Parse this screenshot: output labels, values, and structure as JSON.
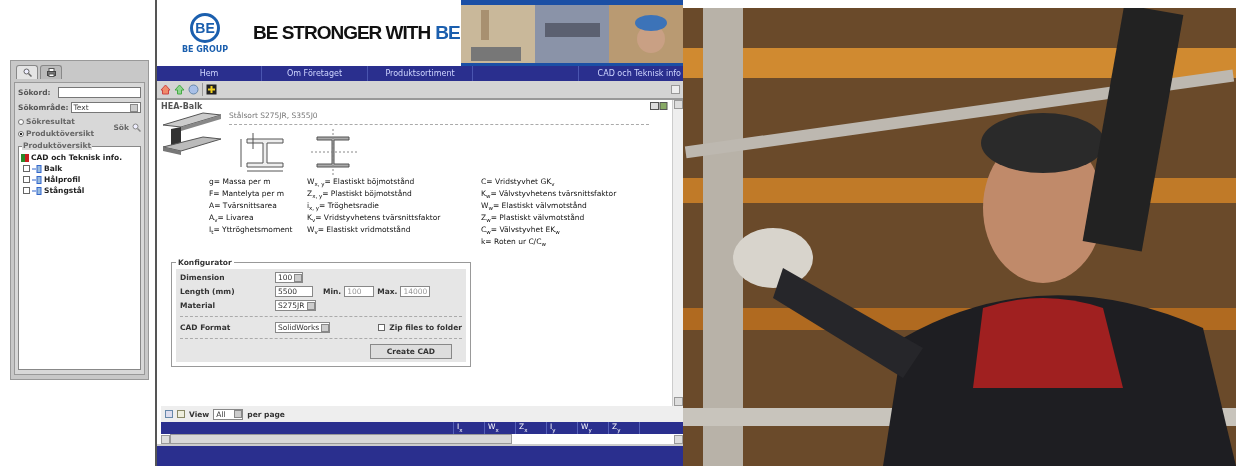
{
  "sidebar": {
    "tabs": [
      {
        "kind": "search",
        "selected": true
      },
      {
        "kind": "print",
        "selected": false
      }
    ],
    "fields": [
      {
        "kind": "text",
        "label": "Sökord:"
      },
      {
        "kind": "select",
        "label": "Sökområde:",
        "value": "Text"
      }
    ],
    "radios": [
      {
        "label": "Sökresultat",
        "selected": false
      },
      {
        "label": "Produktöversikt",
        "selected": true
      }
    ],
    "search_button": "Sök",
    "tree": {
      "title": "Produktöversikt",
      "items": [
        {
          "label": "CAD och Teknisk info.",
          "children": [
            {
              "label": "Balk",
              "expanded": false
            },
            {
              "label": "Hålprofil",
              "expanded": false
            },
            {
              "label": "Stångstål",
              "expanded": false
            }
          ]
        }
      ]
    }
  },
  "header": {
    "logo": "BE",
    "logo_caption": "BE GROUP",
    "slogan": "BE STRONGER WITH",
    "slogan_accent": "BE"
  },
  "nav": [
    {
      "label": "Hem"
    },
    {
      "label": "Om Företaget"
    },
    {
      "label": "Produktsortiment"
    },
    {
      "label": "CAD och Teknisk info"
    }
  ],
  "product": {
    "title": "HEA-Balk",
    "steel_grades": "Stålsort S275JR, S355J0",
    "legend_columns": [
      [
        "g= Massa per m",
        "F= Mantelyta per m",
        "A= Tvärsnittsarea",
        "A$_{v}$= Livarea",
        "I$_{t}$= Yttröghetsmoment"
      ],
      [
        "W$_{x, y}$= Elastiskt böjmotstånd",
        "Z$_{x, y}$= Plastiskt böjmotstånd",
        "i$_{x, y}$= Tröghetsradie",
        "K$_{v}$= Vridstyvhetens tvärsnittsfaktor",
        "W$_{v}$= Elastiskt vridmotstånd"
      ],
      [
        "C= Vridstyvhet GK$_{v}$",
        "K$_{w}$= Välvstyvhetens tvärsnittsfaktor",
        "W$_{w}$= Elastiskt välvmotstånd",
        "Z$_{w}$= Plastiskt välvmotstånd",
        "C$_{w}$= Välvstyvhet EK$_{w}$",
        "k= Roten ur C/C$_{w}$"
      ]
    ]
  },
  "configurator": {
    "title": "Konfigurator",
    "dimension": {
      "label": "Dimension",
      "value": "100"
    },
    "length": {
      "label": "Length (mm)",
      "value": "5500",
      "min_label": "Min.",
      "min": "100",
      "max_label": "Max.",
      "max": "14000"
    },
    "material": {
      "label": "Material",
      "value": "S275JR"
    },
    "cad_format": {
      "label": "CAD Format",
      "value": "SolidWorks"
    },
    "zip": {
      "label": "Zip files to folder",
      "checked": false
    },
    "create_button": "Create CAD"
  },
  "grid": {
    "view_label": "View",
    "view_value": "All",
    "per_page": "per page",
    "columns": [
      "I$_{x}$",
      "W$_{x}$",
      "Z$_{x}$",
      "I$_{y}$",
      "W$_{y}$",
      "Z$_{y}$"
    ]
  }
}
